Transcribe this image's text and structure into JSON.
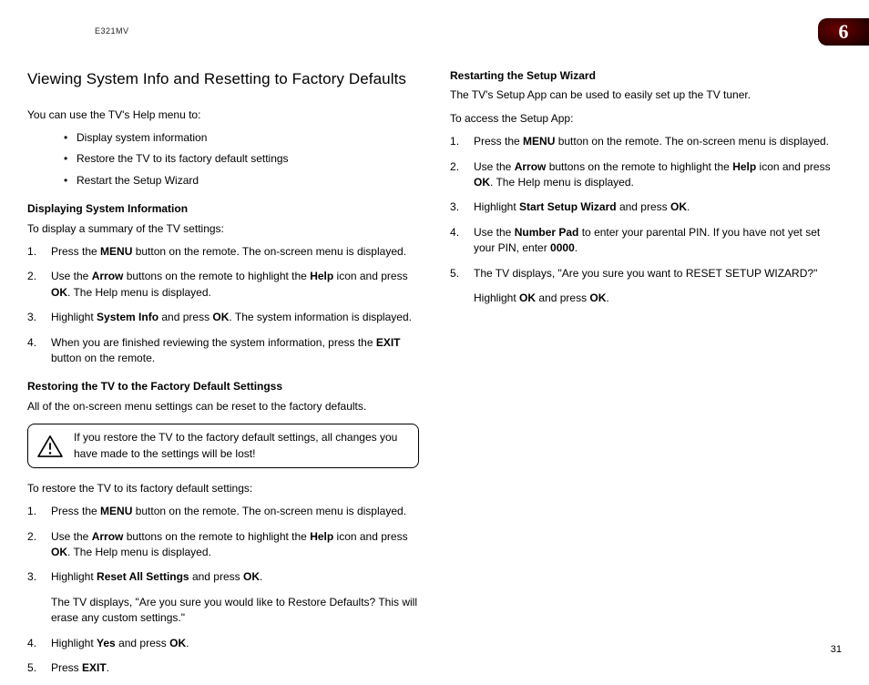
{
  "model": "E321MV",
  "chapter": "6",
  "pageNumber": "31",
  "left": {
    "heading": "Viewing System Info and Resetting to Factory Defaults",
    "intro": "You can use the TV's Help menu to:",
    "bullets": [
      "Display system information",
      "Restore the TV to its factory default settings",
      "Restart the Setup Wizard"
    ],
    "sec1h": "Displaying System Information",
    "sec1p": "To display a summary of the TV settings:",
    "sec1ol": [
      "Press the <b>MENU</b> button on the remote. The on-screen menu is displayed.",
      "Use the <b>Arrow</b> buttons on the remote to highlight the <b>Help</b> icon and press <b>OK</b>. The Help menu is displayed.",
      "Highlight <b>System Info</b> and press <b>OK</b>. The system information is displayed.",
      "When you are finished reviewing the system information, press the <b>EXIT</b> button on the remote."
    ],
    "sec2h": "Restoring the TV to the Factory Default Settingss",
    "sec2p": "All of the on-screen menu settings can be reset to the factory defaults.",
    "warning": "If you restore the TV to the factory default settings, all changes you have made to the settings will be lost!",
    "sec2p2": "To restore the TV to its factory default settings:",
    "sec2ol": [
      "Press the <b>MENU</b> button on the remote. The on-screen menu is displayed.",
      "Use the <b>Arrow</b> buttons on the remote to highlight the <b>Help</b> icon and press <b>OK</b>. The Help menu is displayed.",
      "Highlight <b>Reset All Settings</b> and press <b>OK</b>.<span class=\"sub\">The TV displays, \"Are you sure you would like to Restore Defaults? This will erase any custom settings.\"</span>",
      "Highlight <b>Yes</b> and press <b>OK</b>.",
      "Press <b>EXIT</b>."
    ]
  },
  "right": {
    "sec1h": "Restarting the Setup Wizard",
    "sec1p1": "The TV's Setup App can be used to easily set up the TV tuner.",
    "sec1p2": "To access the Setup App:",
    "sec1ol": [
      "Press the <b>MENU</b> button on the remote. The on-screen menu is displayed.",
      "Use the <b>Arrow</b> buttons on the remote to highlight the <b>Help</b> icon and press <b>OK</b>. The Help menu is displayed.",
      "Highlight <b>Start Setup Wizard</b> and press <b>OK</b>.",
      "Use the <b>Number Pad</b> to enter your parental PIN. If you have not yet set your PIN, enter <b>0000</b>.",
      "The TV displays, \"Are you sure you want to RESET SETUP WIZARD?\"<span class=\"sub\">Highlight <b>OK</b> and press <b>OK</b>.</span>"
    ]
  }
}
